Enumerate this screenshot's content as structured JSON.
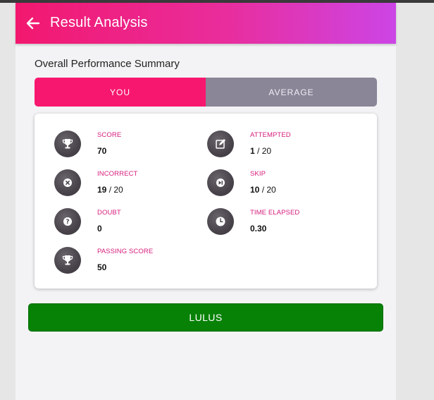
{
  "header": {
    "title": "Result Analysis",
    "back_icon": "arrow-left-icon"
  },
  "summary": {
    "title": "Overall Performance Summary"
  },
  "tabs": [
    {
      "label": "YOU",
      "active": true
    },
    {
      "label": "AVERAGE",
      "active": false
    }
  ],
  "stats": {
    "score": {
      "label": "SCORE",
      "value": "70",
      "icon": "trophy-icon"
    },
    "attempted": {
      "label": "ATTEMPTED",
      "value": "1",
      "total": "/ 20",
      "icon": "edit-icon"
    },
    "incorrect": {
      "label": "INCORRECT",
      "value": "19",
      "total": "/ 20",
      "icon": "x-circle-icon"
    },
    "skip": {
      "label": "SKIP",
      "value": "10",
      "total": "/ 20",
      "icon": "skip-forward-icon"
    },
    "doubt": {
      "label": "DOUBT",
      "value": "0",
      "icon": "question-icon"
    },
    "time_elapsed": {
      "label": "TIME ELAPSED",
      "value": "0.30",
      "icon": "clock-icon"
    },
    "passing_score": {
      "label": "PASSING SCORE",
      "value": "50",
      "icon": "trophy-icon"
    }
  },
  "result_button": {
    "label": "LULUS"
  },
  "colors": {
    "header_start": "#f2186f",
    "header_end": "#cc45e6",
    "tab_active": "#f8176f",
    "tab_inactive": "#8a8597",
    "stat_label": "#d61c7b",
    "pass_green": "#078207"
  }
}
